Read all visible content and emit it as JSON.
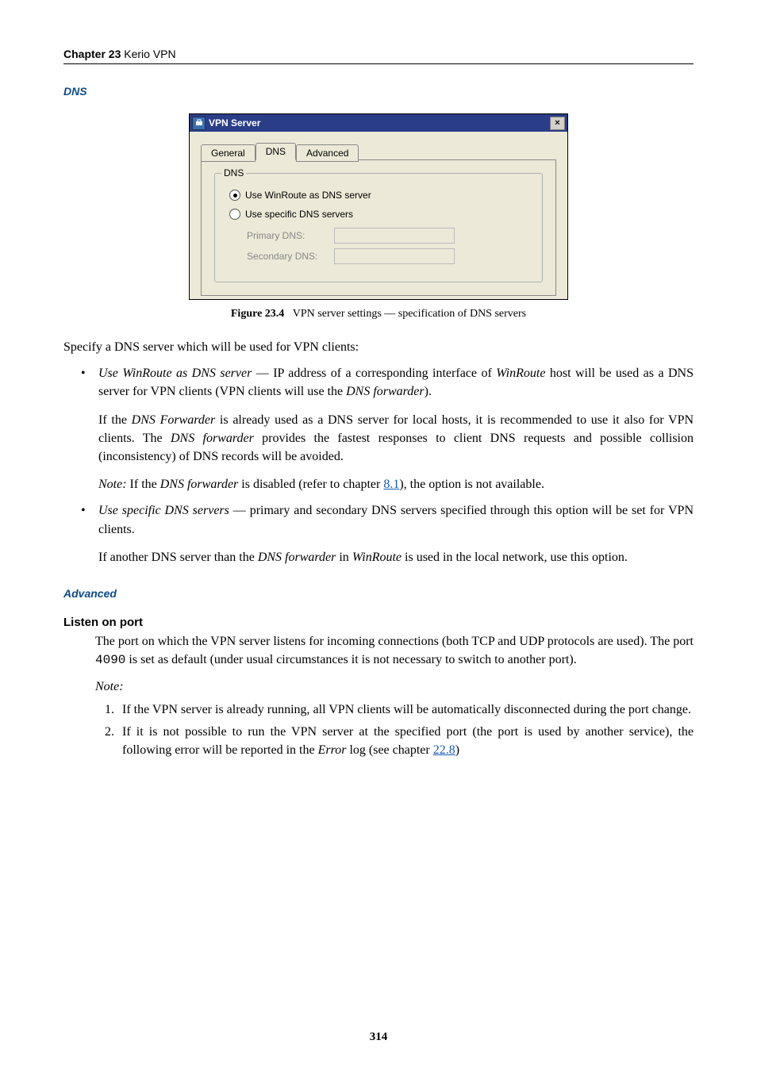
{
  "header": {
    "chapter_label": "Chapter 23",
    "chapter_title": "Kerio VPN"
  },
  "section_dns_title": "DNS",
  "dialog": {
    "title": "VPN Server",
    "close_symbol": "×",
    "tabs": {
      "general": "General",
      "dns": "DNS",
      "advanced": "Advanced"
    },
    "groupbox_label": "DNS",
    "radio_winroute": "Use WinRoute as DNS server",
    "radio_specific": "Use specific DNS servers",
    "primary_label": "Primary DNS:",
    "secondary_label": "Secondary DNS:"
  },
  "figure": {
    "label": "Figure 23.4",
    "caption": "VPN server settings — specification of DNS servers"
  },
  "intro_para": "Specify a DNS server which will be used for VPN clients:",
  "bullet1": {
    "lead": "Use WinRoute as DNS server",
    "rest1": " — IP address of a corresponding interface of ",
    "winroute": "WinRoute",
    "rest2": " host will be used as a DNS server for VPN clients (VPN clients will use the ",
    "dnsfw": "DNS forwarder",
    "rest3": ").",
    "p2a": "If the ",
    "p2b": "DNS Forwarder",
    "p2c": " is already used as a DNS server for local hosts, it is recommended to use it also for VPN clients. The ",
    "p2d": "DNS forwarder",
    "p2e": " provides the fastest responses to client DNS requests and possible collision (inconsistency) of DNS records will be avoided.",
    "note_a": "Note:",
    "note_b": " If the ",
    "note_c": "DNS forwarder",
    "note_d": " is disabled (refer to chapter ",
    "note_link": "8.1",
    "note_e": "), the option is not available."
  },
  "bullet2": {
    "lead": "Use specific DNS servers",
    "rest": " — primary and secondary DNS servers specified through this option will be set for VPN clients.",
    "p2a": "If another DNS server than the ",
    "p2b": "DNS forwarder",
    "p2c": " in ",
    "p2d": "WinRoute",
    "p2e": " is used in the local network, use this option."
  },
  "section_adv_title": "Advanced",
  "listen_heading": "Listen on port",
  "listen_p1a": "The port on which the VPN server listens for incoming connections (both TCP and UDP protocols are used). The port ",
  "listen_port": "4090",
  "listen_p1b": " is set as default (under usual circumstances it is not necessary to switch to another port).",
  "listen_note": "Note:",
  "ol1": "If the VPN server is already running, all VPN clients will be automatically disconnected during the port change.",
  "ol2a": "If it is not possible to run the VPN server at the specified port (the port is used by another service), the following error will be reported in the ",
  "ol2b": "Error",
  "ol2c": " log (see chapter ",
  "ol2link": "22.8",
  "ol2d": ")",
  "page_number": "314"
}
